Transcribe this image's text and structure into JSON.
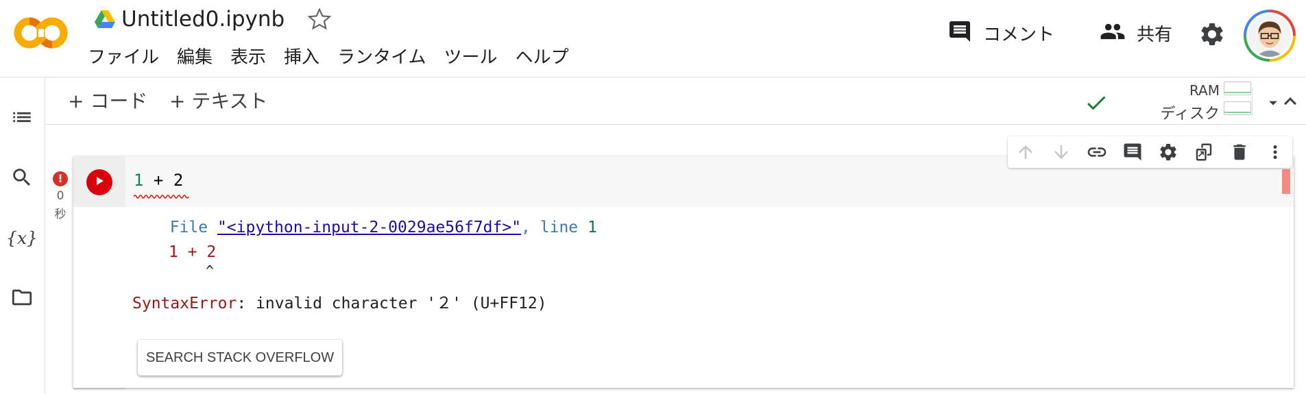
{
  "header": {
    "logo_text": "CO",
    "title": "Untitled0.ipynb",
    "menu": [
      "ファイル",
      "編集",
      "表示",
      "挿入",
      "ランタイム",
      "ツール",
      "ヘルプ"
    ],
    "comment_label": "コメント",
    "share_label": "共有"
  },
  "toolbar": {
    "add_code_label": "+ コード",
    "add_text_label": "+ テキスト",
    "ram_label": "RAM",
    "disk_label": "ディスク",
    "ram_fraction": 0.0,
    "disk_fraction": 0.0
  },
  "cell": {
    "execution_count": "0",
    "execution_unit": "秒",
    "status": "error",
    "code_parts": [
      "1",
      " + ",
      "2"
    ]
  },
  "output": {
    "file_prefix": "  File ",
    "file_link": "\"<ipython-input-2-0029ae56f7df>\"",
    "line_sep": ", ",
    "line_word": "line ",
    "line_number": "1",
    "code_text": "1 + 2",
    "caret": "^",
    "error_name": "SyntaxError",
    "error_message": ": invalid character '２' (U+FF12)",
    "search_button_label": "SEARCH STACK OVERFLOW"
  },
  "colors": {
    "run_button": "#d9000c",
    "error_badge": "#d93025",
    "connected_check": "#188038",
    "error_text": "#a31515",
    "link": "#1a0dab"
  },
  "icons": {
    "sidebar": [
      "table-of-contents-icon",
      "search-icon",
      "variables-icon",
      "folder-icon"
    ],
    "cell_toolbar": [
      "arrow-up-icon",
      "arrow-down-icon",
      "link-icon",
      "comment-icon",
      "gear-icon",
      "mirror-cell-icon",
      "delete-icon",
      "more-vert-icon"
    ]
  }
}
